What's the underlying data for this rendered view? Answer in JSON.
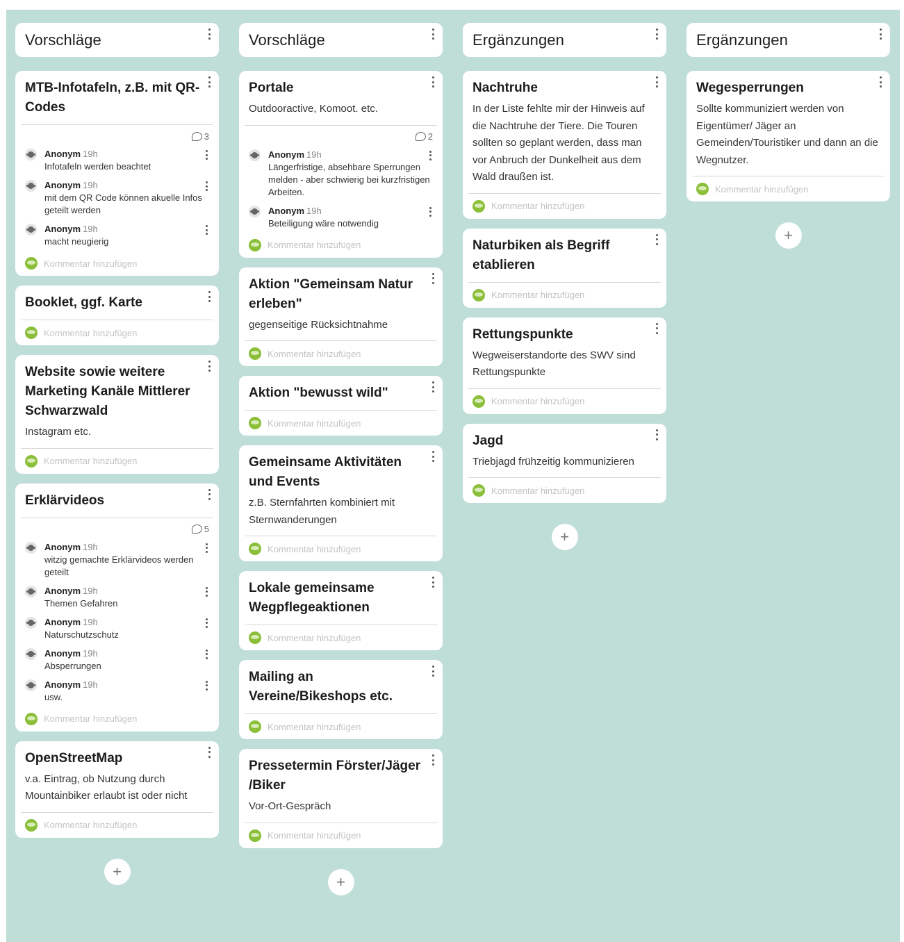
{
  "columns": [
    {
      "title": "Vorschläge",
      "cards": [
        {
          "title": "MTB-Infotafeln, z.B. mit QR-Codes",
          "body": "",
          "comment_count": "3",
          "comments": [
            {
              "author": "Anonym",
              "time": "19h",
              "text": "Infotafeln werden beachtet"
            },
            {
              "author": "Anonym",
              "time": "19h",
              "text": "mit dem QR Code können akuelle Infos geteilt werden"
            },
            {
              "author": "Anonym",
              "time": "19h",
              "text": "macht neugierig"
            }
          ]
        },
        {
          "title": "Booklet, ggf. Karte",
          "body": "",
          "comment_count": "",
          "comments": []
        },
        {
          "title": "Website sowie weitere Marketing Kanäle Mittlerer Schwarzwald",
          "body": "Instagram etc.",
          "comment_count": "",
          "comments": []
        },
        {
          "title": "Erklärvideos",
          "body": "",
          "comment_count": "5",
          "comments": [
            {
              "author": "Anonym",
              "time": "19h",
              "text": "witzig gemachte Erklärvideos werden geteilt"
            },
            {
              "author": "Anonym",
              "time": "19h",
              "text": "Themen Gefahren"
            },
            {
              "author": "Anonym",
              "time": "19h",
              "text": "Naturschutzschutz"
            },
            {
              "author": "Anonym",
              "time": "19h",
              "text": "Absperrungen"
            },
            {
              "author": "Anonym",
              "time": "19h",
              "text": "usw."
            }
          ]
        },
        {
          "title": "OpenStreetMap",
          "body": "v.a. Eintrag, ob Nutzung durch Mountainbiker erlaubt ist oder nicht",
          "comment_count": "",
          "comments": []
        }
      ]
    },
    {
      "title": "Vorschläge",
      "cards": [
        {
          "title": "Portale",
          "body": "Outdooractive, Komoot. etc.",
          "comment_count": "2",
          "comments": [
            {
              "author": "Anonym",
              "time": "19h",
              "text": "Längerfristige, absehbare Sperrungen melden - aber schwierig bei kurzfristigen Arbeiten."
            },
            {
              "author": "Anonym",
              "time": "19h",
              "text": "Beteiligung wäre notwendig"
            }
          ]
        },
        {
          "title": "Aktion \"Gemeinsam Natur erleben\"",
          "body": "gegenseitige Rücksichtnahme",
          "comment_count": "",
          "comments": []
        },
        {
          "title": "Aktion \"bewusst wild\"",
          "body": "",
          "comment_count": "",
          "comments": []
        },
        {
          "title": "Gemeinsame Aktivitäten und Events",
          "body": "z.B. Sternfahrten kombiniert mit Sternwanderungen",
          "comment_count": "",
          "comments": []
        },
        {
          "title": "Lokale gemeinsame Wegpflegeaktionen",
          "body": "",
          "comment_count": "",
          "comments": []
        },
        {
          "title": "Mailing an Vereine/Bikeshops etc.",
          "body": "",
          "comment_count": "",
          "comments": []
        },
        {
          "title": "Pressetermin Förster/Jäger /Biker",
          "body": "Vor-Ort-Gespräch",
          "comment_count": "",
          "comments": []
        }
      ]
    },
    {
      "title": "Ergänzungen",
      "cards": [
        {
          "title": "Nachtruhe",
          "body": "In der Liste fehlte mir der Hinweis auf die Nachtruhe der Tiere. Die Touren sollten so geplant werden, dass man vor Anbruch der Dunkelheit aus dem Wald draußen ist.",
          "comment_count": "",
          "comments": []
        },
        {
          "title": "Naturbiken als Begriff etablieren",
          "body": "",
          "comment_count": "",
          "comments": []
        },
        {
          "title": "Rettungspunkte",
          "body": "Wegweiserstandorte des SWV sind Rettungspunkte",
          "comment_count": "",
          "comments": []
        },
        {
          "title": "Jagd",
          "body": "Triebjagd frühzeitig kommunizieren",
          "comment_count": "",
          "comments": []
        }
      ]
    },
    {
      "title": "Ergänzungen",
      "cards": [
        {
          "title": "Wegesperrungen",
          "body": "Sollte kommuniziert werden von Eigentümer/ Jäger an Gemeinden/Touristiker und dann an die Wegnutzer.",
          "comment_count": "",
          "comments": []
        }
      ]
    }
  ],
  "add_comment_placeholder": "Kommentar hinzufügen",
  "add_card_label": "+",
  "colors": {
    "board_background": "#bfded8",
    "card_background": "#ffffff",
    "avatar_green": "#8bbf3a"
  }
}
